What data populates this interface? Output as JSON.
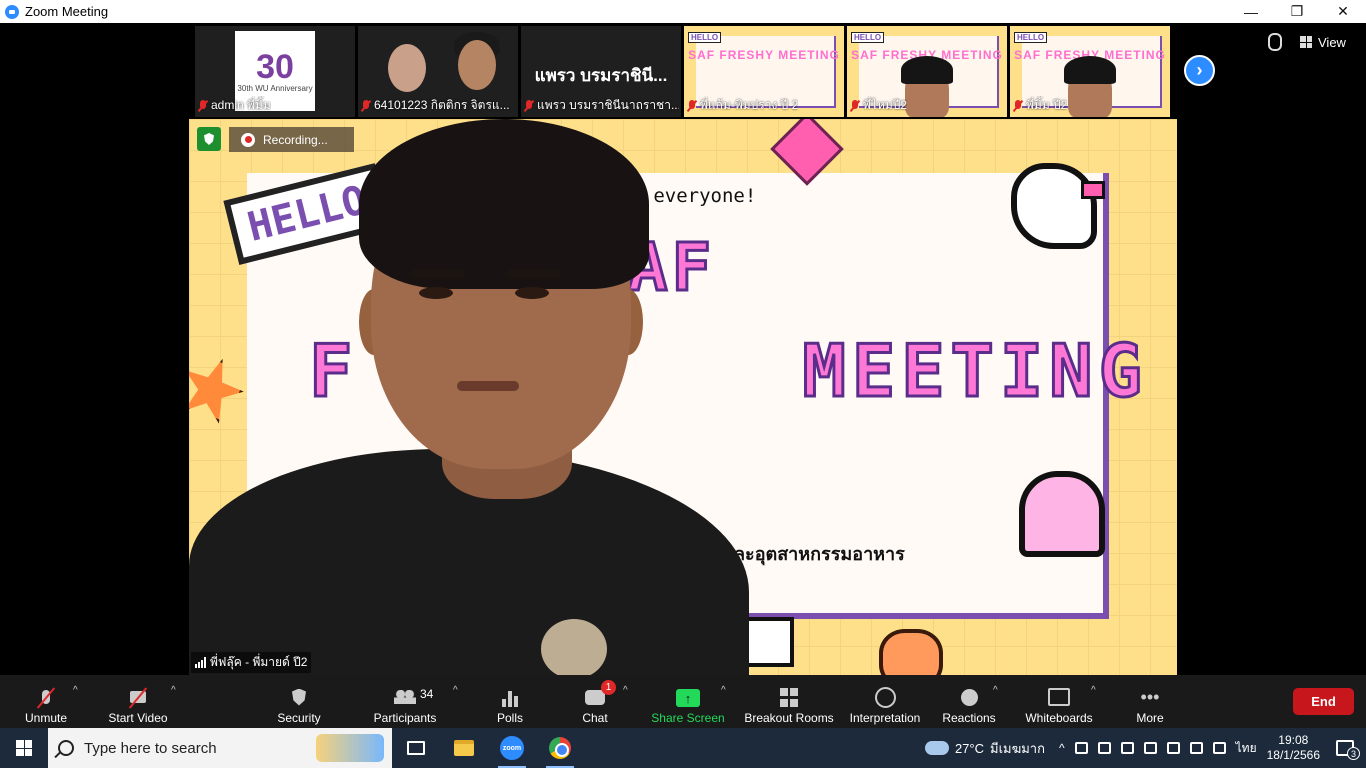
{
  "window": {
    "title": "Zoom Meeting",
    "controls": {
      "minimize": "—",
      "restore": "❐",
      "close": "✕"
    }
  },
  "header": {
    "view_label": "View",
    "next_page": "›"
  },
  "thumbnails": [
    {
      "name": "admin พี่มิ้ม",
      "kind": "logo",
      "logo_text": "30",
      "logo_sub": "30th WU Anniversary"
    },
    {
      "name": "64101223 กิตติกร จิตรแ...",
      "kind": "camera"
    },
    {
      "name": "แพรว บรมราชินีนาถราชา...",
      "kind": "name",
      "display_name": "แพรว บรมราชินี..."
    },
    {
      "name": "พี่แก้ม-พิมปราง ปี 2",
      "kind": "slide",
      "slide_text": "SAF FRESHY MEETING"
    },
    {
      "name": "พี่ไหมปี2",
      "kind": "slide-person",
      "slide_text": "SAF FRESHY MEETING"
    },
    {
      "name": "พี่มิ้ม ปี2",
      "kind": "slide-person",
      "slide_text": "SAF FRESHY MEETING"
    }
  ],
  "main_video": {
    "recording_label": "Recording...",
    "speaker_name": "พี่ฟลุ๊ค - พี่มายด์ ปี2",
    "slide": {
      "hello_badge": "HELLO",
      "greeting": "lo everyone!",
      "title_line1": "SAF",
      "title_line2_left": "F",
      "title_line2_right": "MEETING",
      "footer": "ละอุตสาหกรรมอาหาร"
    }
  },
  "toolbar": {
    "unmute": "Unmute",
    "start_video": "Start Video",
    "security": "Security",
    "participants": "Participants",
    "participants_count": "34",
    "polls": "Polls",
    "chat": "Chat",
    "chat_badge": "1",
    "share_screen": "Share Screen",
    "share_arrow": "↑",
    "breakout_rooms": "Breakout Rooms",
    "interpretation": "Interpretation",
    "reactions": "Reactions",
    "whiteboards": "Whiteboards",
    "more": "More",
    "more_dots": "•••",
    "end": "End",
    "caret": "^"
  },
  "taskbar": {
    "search_placeholder": "Type here to search",
    "zoom_icon_text": "zoom",
    "weather": "27°C",
    "weather_desc": "มีเมฆมาก",
    "tray_chevron": "^",
    "language": "ไทย",
    "time": "19:08",
    "date": "18/1/2566",
    "notification_count": "3"
  },
  "colors": {
    "zoom_blue": "#2d8cff",
    "end_red": "#c8161d",
    "share_green": "#23d959",
    "slide_yellow": "#ffe08a",
    "slide_pink": "#ff78d6",
    "slide_purple": "#7a4fb0"
  }
}
